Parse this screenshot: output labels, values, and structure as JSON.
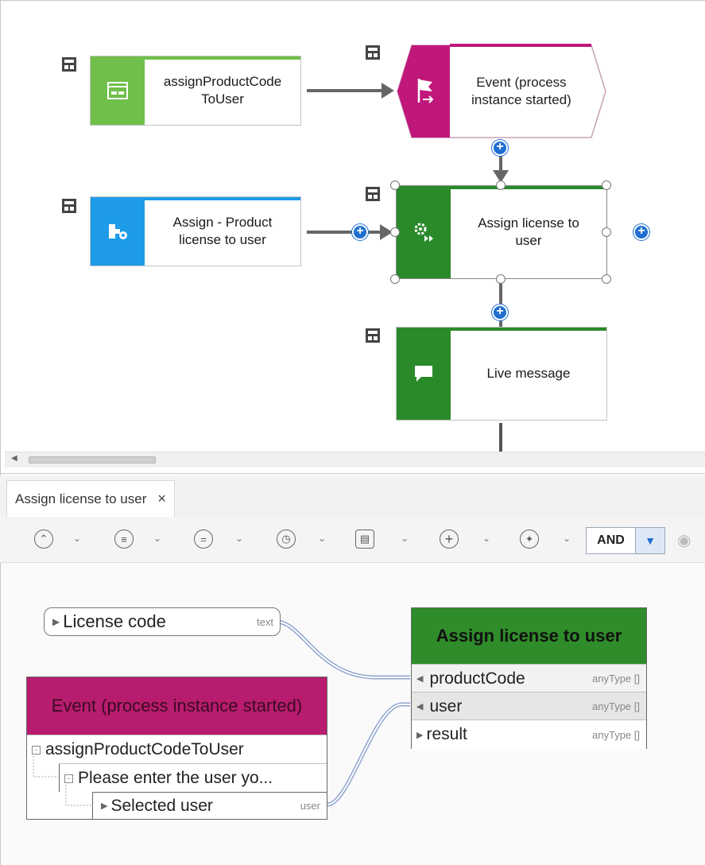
{
  "process": {
    "node1": {
      "label": "assignProductCode\nToUser",
      "color": "#6fbf4a"
    },
    "node2": {
      "label": "Event (process\ninstance started)",
      "color": "#c0187a"
    },
    "node3": {
      "label": "Assign - Product\nlicense to user",
      "color": "#1e9be9"
    },
    "node4": {
      "label": "Assign license to\nuser",
      "color": "#2a8a2a"
    },
    "node5": {
      "label": "Live message",
      "color": "#2a8a2a"
    }
  },
  "panel": {
    "tab_label": "Assign license to user",
    "tab_close": "×",
    "toolbar": {
      "and_value": "AND"
    }
  },
  "mapping": {
    "source_license": {
      "label": "License code",
      "type": "text"
    },
    "target_box": {
      "title": "Assign license to user",
      "color": "#2f8c2a",
      "rows": [
        {
          "label": "productCode",
          "type": "anyType []"
        },
        {
          "label": "user",
          "type": "anyType []"
        },
        {
          "label": "result",
          "type": "anyType []"
        }
      ]
    },
    "event_box": {
      "title": "Event (process instance started)",
      "color": "#b71c6e",
      "rows": [
        {
          "label": "assignProductCodeToUser"
        },
        {
          "label": "Please enter the user yo..."
        },
        {
          "label": "Selected user",
          "type": "user"
        }
      ]
    }
  }
}
